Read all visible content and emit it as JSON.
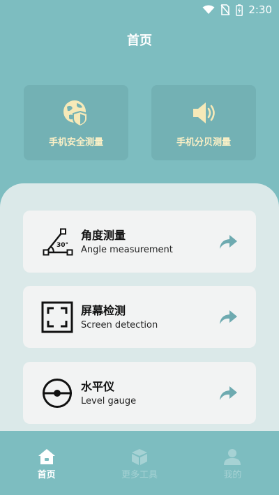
{
  "status_bar": {
    "time": "2:30",
    "icons": [
      "wifi-icon",
      "no-sim-icon",
      "battery-charging-icon"
    ]
  },
  "header": {
    "title": "首页"
  },
  "top_cards": [
    {
      "label": "手机安全测量",
      "icon": "shield-globe-icon"
    },
    {
      "label": "手机分贝测量",
      "icon": "speaker-icon"
    }
  ],
  "tools": [
    {
      "title": "角度测量",
      "subtitle": "Angle measurement",
      "icon": "angle-icon",
      "icon_text": "30°"
    },
    {
      "title": "屏幕检测",
      "subtitle": "Screen detection",
      "icon": "screen-frame-icon"
    },
    {
      "title": "水平仪",
      "subtitle": "Level gauge",
      "icon": "level-icon"
    }
  ],
  "bottom_nav": [
    {
      "label": "首页",
      "icon": "home-icon",
      "active": true
    },
    {
      "label": "更多工具",
      "icon": "cube-icon",
      "active": false
    },
    {
      "label": "我的",
      "icon": "user-icon",
      "active": false
    }
  ],
  "colors": {
    "background": "#7dbdc0",
    "card": "#73b1b4",
    "card_text": "#fbf0c6",
    "panel": "#dbe9e9",
    "tool_card": "#f2f3f3",
    "arrow": "#6eaab0"
  }
}
